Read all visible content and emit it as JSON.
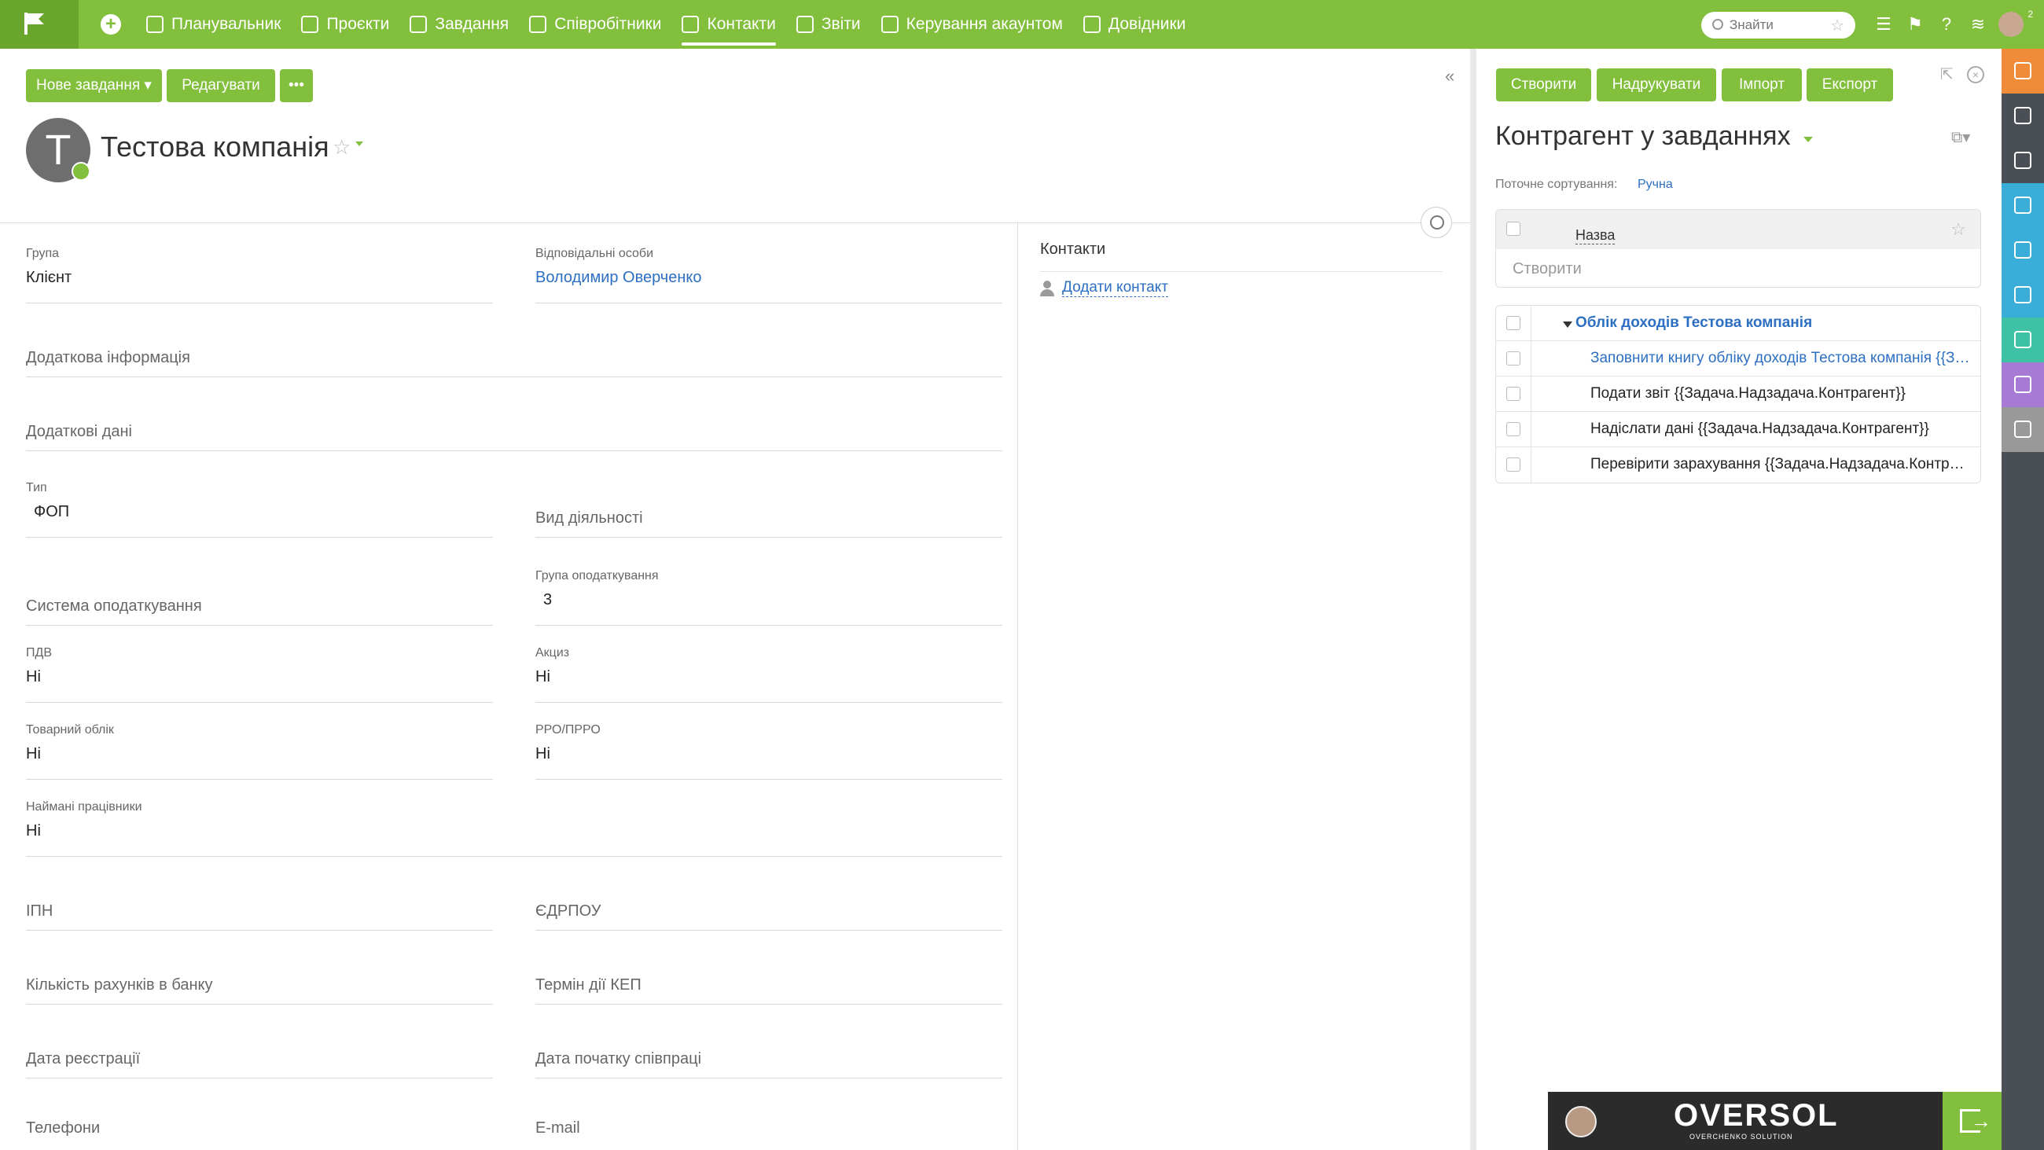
{
  "nav": {
    "items": [
      {
        "label": "Планувальник",
        "icon": "planner-icon"
      },
      {
        "label": "Проєкти",
        "icon": "projects-icon"
      },
      {
        "label": "Завдання",
        "icon": "tasks-icon"
      },
      {
        "label": "Співробітники",
        "icon": "employees-icon"
      },
      {
        "label": "Контакти",
        "icon": "contacts-icon",
        "active": true
      },
      {
        "label": "Звіти",
        "icon": "reports-icon"
      },
      {
        "label": "Керування акаунтом",
        "icon": "account-icon"
      },
      {
        "label": "Довідники",
        "icon": "directories-icon"
      }
    ],
    "search_placeholder": "Знайти",
    "avatar_badge": "2"
  },
  "toolbar": {
    "new_task": "Нове завдання ▾",
    "edit": "Редагувати",
    "more": "•••"
  },
  "company": {
    "initial": "Т",
    "name": "Тестова компанія"
  },
  "fields": {
    "group": {
      "label": "Група",
      "value": "Клієнт"
    },
    "responsible": {
      "label": "Відповідальні особи",
      "value": "Володимир Оверченко"
    },
    "extra_info": {
      "label": "Додаткова інформація"
    },
    "extra_data": {
      "label": "Додаткові дані"
    },
    "type": {
      "label": "Тип",
      "value": "ФОП"
    },
    "activity": {
      "label": "Вид діяльності"
    },
    "tax_system": {
      "label": "Система оподаткування"
    },
    "tax_group": {
      "label": "Група оподаткування",
      "value": "3"
    },
    "vat": {
      "label": "ПДВ",
      "value": "Ні"
    },
    "excise": {
      "label": "Акциз",
      "value": "Ні"
    },
    "inventory": {
      "label": "Товарний облік",
      "value": "Ні"
    },
    "rro": {
      "label": "РРО/ПРРО",
      "value": "Ні"
    },
    "employees": {
      "label": "Наймані працівники",
      "value": "Ні"
    },
    "ipn": {
      "label": "ІПН"
    },
    "edrpou": {
      "label": "ЄДРПОУ"
    },
    "bank_accounts": {
      "label": "Кількість рахунків в банку"
    },
    "kep_term": {
      "label": "Термін дії КЕП"
    },
    "reg_date": {
      "label": "Дата реєстрації"
    },
    "coop_start": {
      "label": "Дата початку співпраці"
    },
    "phones": {
      "label": "Телефони"
    },
    "email": {
      "label": "E-mail"
    }
  },
  "contacts": {
    "title": "Контакти",
    "add": "Додати контакт"
  },
  "panel": {
    "buttons": {
      "create": "Створити",
      "print": "Надрукувати",
      "import": "Імпорт",
      "export": "Експорт"
    },
    "title": "Контрагент у завданнях",
    "sort_label": "Поточне сортування:",
    "sort_value": "Ручна",
    "column_name": "Назва",
    "create_row": "Створити",
    "tasks": [
      {
        "title": "Облік доходів Тестова компанія",
        "kind": "parent"
      },
      {
        "title": "Заповнити книгу обліку доходів Тестова компанія {{Задача.Надзадача.Контрагент}}",
        "kind": "link"
      },
      {
        "title": "Подати звіт {{Задача.Надзадача.Контрагент}}",
        "kind": "plain"
      },
      {
        "title": "Надіслати дані {{Задача.Надзадача.Контрагент}}",
        "kind": "plain"
      },
      {
        "title": "Перевірити зарахування {{Задача.Надзадача.Контрагент}}",
        "kind": "plain"
      }
    ]
  },
  "sidebar_colors": [
    "#f08b3a",
    "#4a4f55",
    "#4a4f55",
    "#3aaed8",
    "#3aaed8",
    "#3aaed8",
    "#3fc1a6",
    "#a77ad6",
    "#999999"
  ],
  "sidebar_icons": [
    "chat-icon",
    "edit-icon",
    "task-check-icon",
    "folder-icon",
    "documents-icon",
    "clipboard-icon",
    "key-icon",
    "analytics-icon",
    "activity-icon"
  ],
  "banner": {
    "brand": "OVERSOL",
    "sub": "OVERCHENKO SOLUTION"
  },
  "colors": {
    "accent": "#82bf3c",
    "link": "#2d6fc2",
    "sidebar": "#4a4f55"
  }
}
